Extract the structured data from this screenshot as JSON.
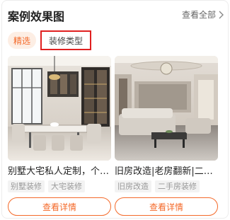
{
  "header": {
    "title": "案例效果图",
    "view_all": "查看全部"
  },
  "tabs": [
    {
      "label": "精选"
    },
    {
      "label": "装修类型"
    }
  ],
  "cases": [
    {
      "title": "别墅大宅私人定制，个性化装修",
      "tags": [
        "别墅装修",
        "大宅装修"
      ],
      "button": "查看详情"
    },
    {
      "title": "旧房改造|老房翻新|二手房装修",
      "tags": [
        "旧房改造",
        "二手房装修"
      ],
      "button": "查看详情"
    }
  ],
  "colors": {
    "accent": "#f46a2a",
    "highlight_border": "#e02020",
    "selected_tab_bg": "#fdeee4"
  },
  "icons": {
    "view_all": "chevron-right-icon"
  }
}
